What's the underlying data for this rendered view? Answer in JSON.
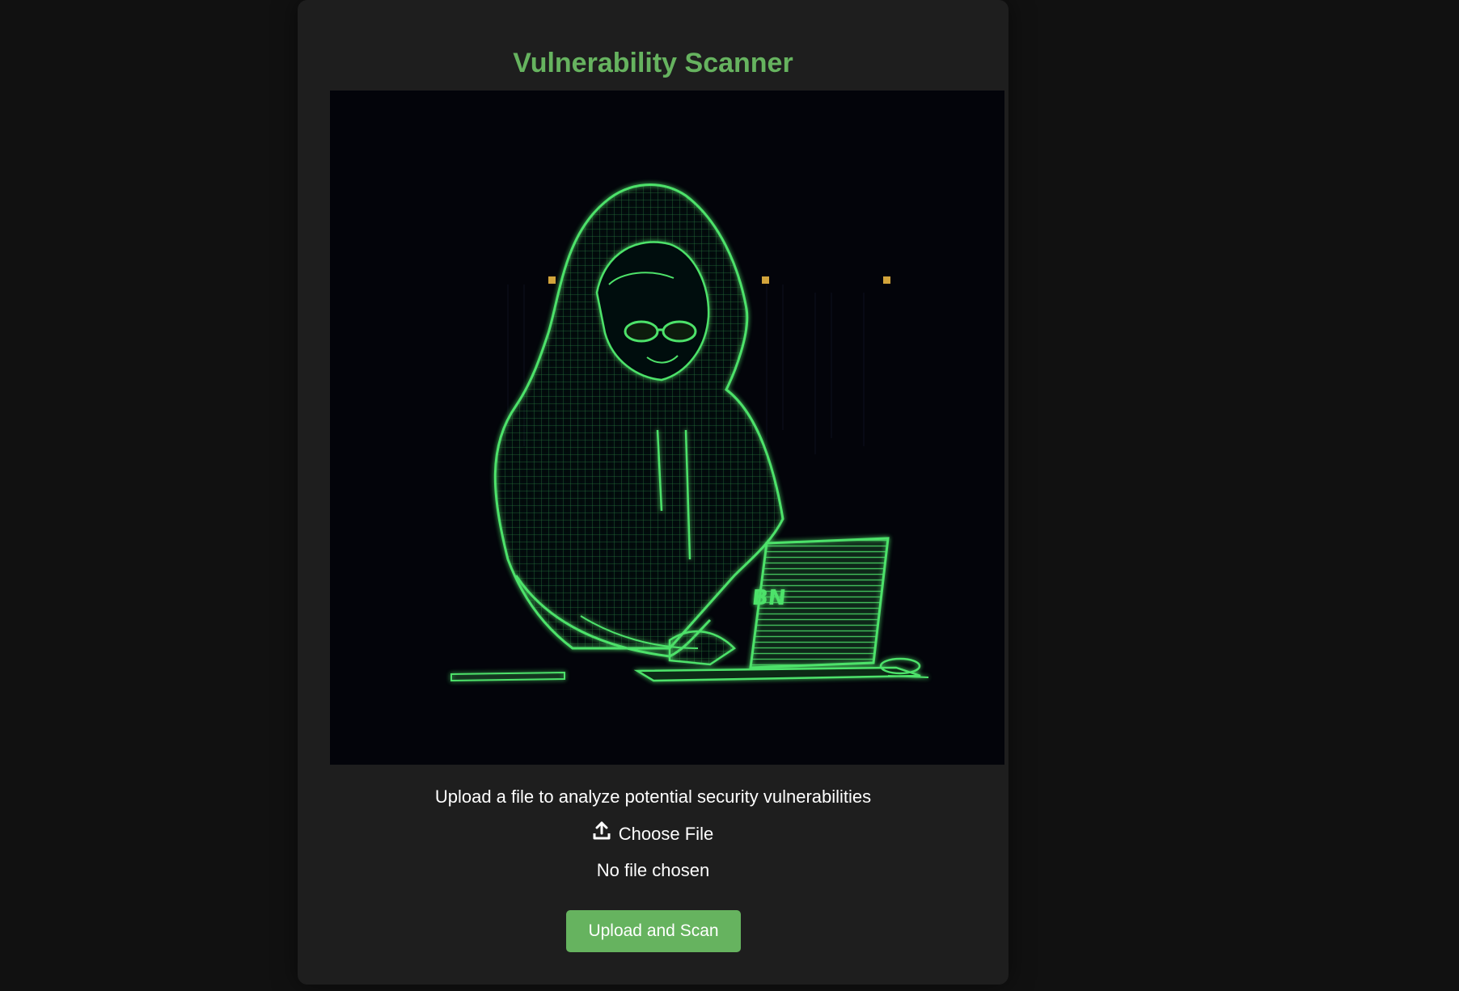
{
  "app": {
    "title": "Vulnerability Scanner"
  },
  "hero": {
    "alt": "Hooded hacker wireframe illustration typing on a laptop",
    "laptop_logo": "BN"
  },
  "upload": {
    "instructions": "Upload a file to analyze potential security vulnerabilities",
    "choose_icon": "upload-icon",
    "choose_label": "Choose File",
    "status": "No file chosen",
    "submit_label": "Upload and Scan"
  },
  "colors": {
    "page_background": "#111111",
    "card_background": "#1e1e1e",
    "accent": "#66b35f",
    "text": "#ffffff",
    "illustration_glow": "#4ee26a"
  }
}
